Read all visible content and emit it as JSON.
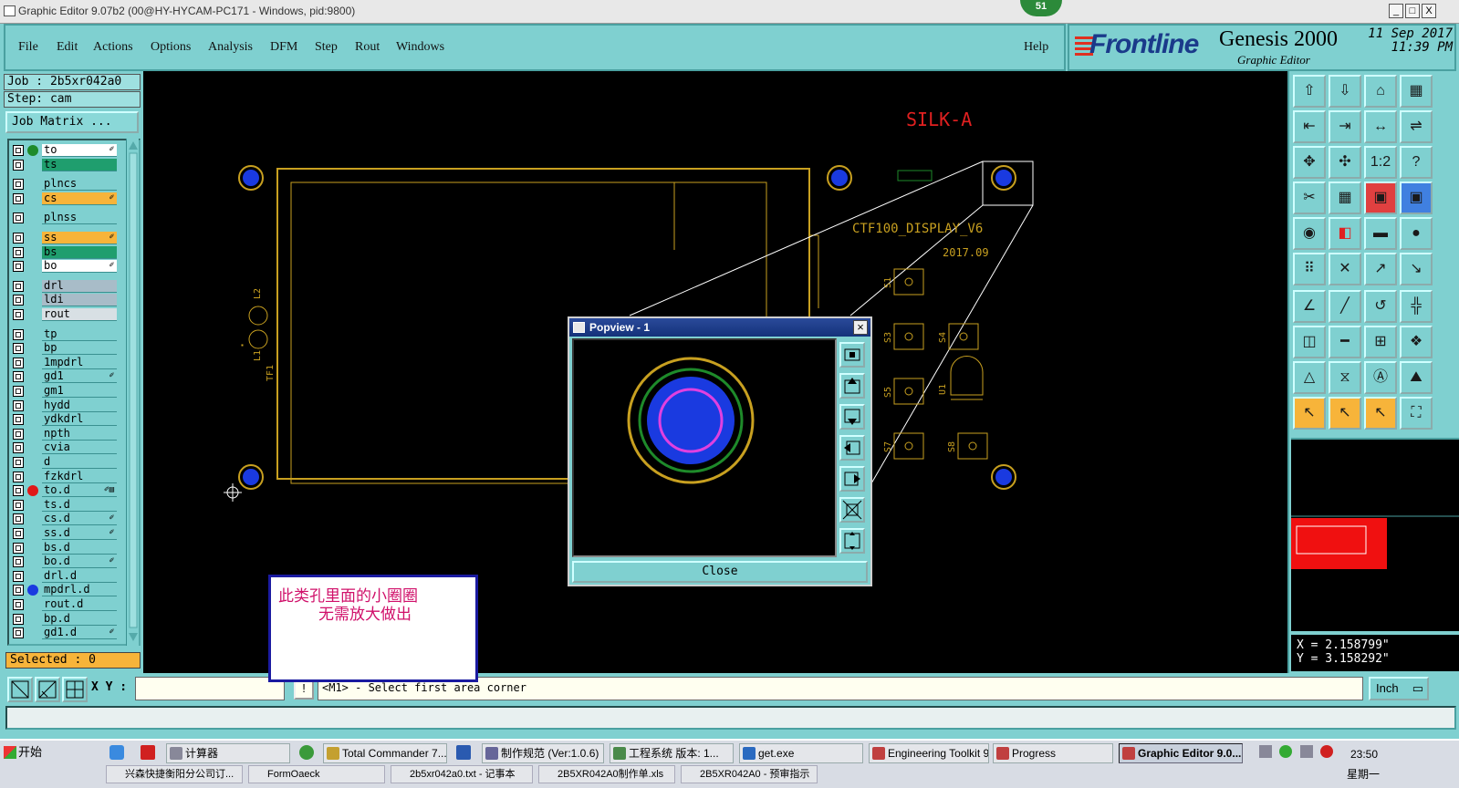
{
  "window": {
    "title": "Graphic Editor 9.07b2 (00@HY-HYCAM-PC171 - Windows, pid:9800)",
    "badge": "51",
    "min_label": "_",
    "max_label": "□",
    "close_label": "X"
  },
  "menu": {
    "items": [
      "File",
      "Edit",
      "Actions",
      "Options",
      "Analysis",
      "DFM",
      "Step",
      "Rout",
      "Windows"
    ],
    "help": "Help"
  },
  "brand": {
    "logo": "Frontline",
    "product": "Genesis 2000",
    "subtitle": "Graphic Editor",
    "date": "11 Sep 2017",
    "time": "11:39 PM"
  },
  "job": {
    "job_label": "Job : 2b5xr042a0",
    "step_label": "Step: cam",
    "matrix_button": "Job Matrix ..."
  },
  "layers": [
    {
      "name": "to",
      "color": "#ffffff",
      "dot": "#1e8a2a",
      "mark": "✐"
    },
    {
      "name": "ts",
      "color": "#1f9e6e",
      "dot": "",
      "mark": ""
    },
    {
      "name": "plncs",
      "color": "#7fd0d0",
      "dot": "",
      "mark": ""
    },
    {
      "name": "cs",
      "color": "#f7b43a",
      "dot": "",
      "mark": "✐"
    },
    {
      "name": "plnss",
      "color": "#7fd0d0",
      "dot": "",
      "mark": ""
    },
    {
      "name": "ss",
      "color": "#f7b43a",
      "dot": "",
      "mark": "✐"
    },
    {
      "name": "bs",
      "color": "#1f9e6e",
      "dot": "",
      "mark": ""
    },
    {
      "name": "bo",
      "color": "#ffffff",
      "dot": "",
      "mark": "✐"
    },
    {
      "name": "drl",
      "color": "#a8bcc8",
      "dot": "",
      "mark": ""
    },
    {
      "name": "ldi",
      "color": "#a8bcc8",
      "dot": "",
      "mark": ""
    },
    {
      "name": "rout",
      "color": "#d8e0e4",
      "dot": "",
      "mark": ""
    },
    {
      "name": "tp",
      "color": "#7fd0d0",
      "dot": "",
      "mark": ""
    },
    {
      "name": "bp",
      "color": "#7fd0d0",
      "dot": "",
      "mark": ""
    },
    {
      "name": "1mpdrl",
      "color": "#7fd0d0",
      "dot": "",
      "mark": ""
    },
    {
      "name": "gd1",
      "color": "#7fd0d0",
      "dot": "",
      "mark": "✐"
    },
    {
      "name": "gm1",
      "color": "#7fd0d0",
      "dot": "",
      "mark": ""
    },
    {
      "name": "hydd",
      "color": "#7fd0d0",
      "dot": "",
      "mark": ""
    },
    {
      "name": "ydkdrl",
      "color": "#7fd0d0",
      "dot": "",
      "mark": ""
    },
    {
      "name": "npth",
      "color": "#7fd0d0",
      "dot": "",
      "mark": ""
    },
    {
      "name": "cvia",
      "color": "#7fd0d0",
      "dot": "",
      "mark": ""
    },
    {
      "name": "d",
      "color": "#7fd0d0",
      "dot": "",
      "mark": ""
    },
    {
      "name": "fzkdrl",
      "color": "#7fd0d0",
      "dot": "",
      "mark": ""
    },
    {
      "name": "to.d",
      "color": "#7fd0d0",
      "dot": "#e01818",
      "mark": "✐▤"
    },
    {
      "name": "ts.d",
      "color": "#7fd0d0",
      "dot": "",
      "mark": ""
    },
    {
      "name": "cs.d",
      "color": "#7fd0d0",
      "dot": "",
      "mark": "✐"
    },
    {
      "name": "ss.d",
      "color": "#7fd0d0",
      "dot": "",
      "mark": "✐"
    },
    {
      "name": "bs.d",
      "color": "#7fd0d0",
      "dot": "",
      "mark": ""
    },
    {
      "name": "bo.d",
      "color": "#7fd0d0",
      "dot": "",
      "mark": "✐"
    },
    {
      "name": "drl.d",
      "color": "#7fd0d0",
      "dot": "",
      "mark": ""
    },
    {
      "name": "mpdrl.d",
      "color": "#7fd0d0",
      "dot": "#1a3ae0",
      "mark": ""
    },
    {
      "name": "rout.d",
      "color": "#7fd0d0",
      "dot": "",
      "mark": ""
    },
    {
      "name": "bp.d",
      "color": "#7fd0d0",
      "dot": "",
      "mark": ""
    },
    {
      "name": "gd1.d",
      "color": "#7fd0d0",
      "dot": "",
      "mark": "✐"
    }
  ],
  "selected": "Selected : 0",
  "canvas": {
    "silk_label": "SILK-A",
    "board_label": "CTF100_DISPLAY_V6",
    "board_date": "2017.09",
    "refs": [
      "S1",
      "S3",
      "S4",
      "S5",
      "S7",
      "S8",
      "U1",
      "L1",
      "L2",
      "TF1"
    ]
  },
  "popview": {
    "title": "Popview - 1",
    "close_label": "Close",
    "side_icons": [
      "zoom-window-icon",
      "pan-up-icon",
      "pan-down-icon",
      "pan-left-icon",
      "pan-right-icon",
      "zoom-in-icon",
      "zoom-out-icon"
    ]
  },
  "note": {
    "line1": "此类孔里面的小圈圈",
    "line2": "无需放大做出"
  },
  "coords": {
    "x": "X = 2.158799\"",
    "y": "Y = 3.158292\""
  },
  "bottom": {
    "xy_label": "X Y :",
    "xy_value": "",
    "info_label": "!",
    "prompt": "<M1> - Select first area corner",
    "unit": "Inch"
  },
  "taskbar": {
    "start": "开始",
    "row1": [
      "计算器",
      "Total Commander 7....",
      "制作规范 (Ver:1.0.6)",
      "工程系统  版本: 1...",
      "get.exe",
      "Engineering Toolkit 9....",
      "Progress",
      "Graphic Editor 9.0..."
    ],
    "row2": [
      "兴森快捷衡阳分公司订...",
      "FormOaeck",
      "2b5xr042a0.txt - 记事本",
      "2B5XR042A0制作单.xls",
      "2B5XR042A0 - 预审指示"
    ],
    "time": "23:50",
    "day": "星期一"
  },
  "colors": {
    "panel": "#7fd0d0",
    "copper": "#c8a020",
    "pad_blue": "#1a3ae0",
    "silk_red": "#e02020"
  }
}
